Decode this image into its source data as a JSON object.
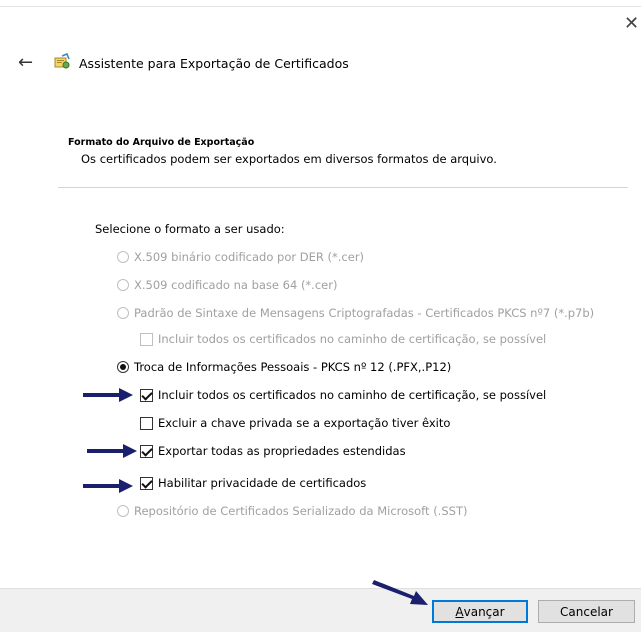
{
  "window": {
    "close_glyph": "✕"
  },
  "nav": {
    "back_glyph": "←"
  },
  "wizard": {
    "title": "Assistente para Exportação de Certificados",
    "icon": "certificate-wizard-icon"
  },
  "header": {
    "title": "Formato do Arquivo de Exportação",
    "description": "Os certificados podem ser exportados em diversos formatos de arquivo."
  },
  "form": {
    "prompt": "Selecione o formato a ser usado:",
    "options": {
      "der": {
        "label": "X.509 binário codificado por DER (*.cer)",
        "checked": false,
        "enabled": false
      },
      "base64": {
        "label": "X.509 codificado na base 64 (*.cer)",
        "checked": false,
        "enabled": false
      },
      "pkcs7": {
        "label": "Padrão de Sintaxe de Mensagens Criptografadas - Certificados PKCS nº7 (*.p7b)",
        "checked": false,
        "enabled": false
      },
      "pkcs7_include_all": {
        "label": "Incluir todos os certificados no caminho de certificação, se possível",
        "checked": false,
        "enabled": false
      },
      "pkcs12": {
        "label": "Troca de Informações Pessoais - PKCS nº 12 (.PFX,.P12)",
        "checked": true,
        "enabled": true
      },
      "pkcs12_include_all": {
        "label": "Incluir todos os certificados no caminho de certificação, se possível",
        "checked": true,
        "enabled": true
      },
      "delete_private_key": {
        "label": "Excluir a chave privada se a exportação tiver êxito",
        "checked": false,
        "enabled": true
      },
      "export_properties": {
        "label": "Exportar todas as propriedades estendidas",
        "checked": true,
        "enabled": true
      },
      "enable_privacy": {
        "label": "Habilitar privacidade de certificados",
        "checked": true,
        "enabled": true
      },
      "sst": {
        "label": "Repositório de Certificados Serializado da Microsoft (.SST)",
        "checked": false,
        "enabled": false
      }
    }
  },
  "buttons": {
    "next": {
      "label": "Avançar",
      "underline_char": "A"
    },
    "cancel": {
      "label": "Cancelar"
    }
  },
  "colors": {
    "arrow": "#1a1f6e",
    "primary_border": "#0078d7",
    "disabled_text": "#a0a0a0"
  }
}
